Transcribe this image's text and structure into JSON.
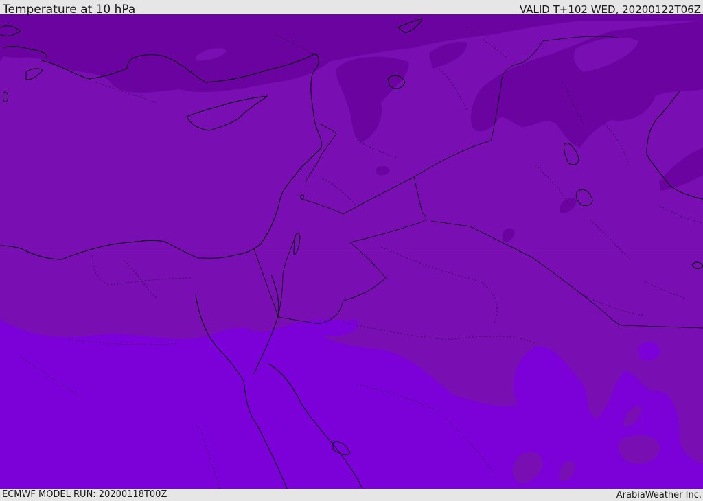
{
  "header": {
    "title": "Temperature at 10 hPa",
    "valid": "VALID T+102 WED, 20200122T06Z"
  },
  "footer": {
    "model_run": "ECMWF MODEL RUN: 20200118T00Z",
    "credit": "ArabiaWeather Inc."
  },
  "colors": {
    "band_cold": "#6a039f",
    "band_mid": "#790fb3",
    "band_warm": "#7c00d8",
    "coastline": "#000000",
    "frame": "#e6e6e6"
  }
}
